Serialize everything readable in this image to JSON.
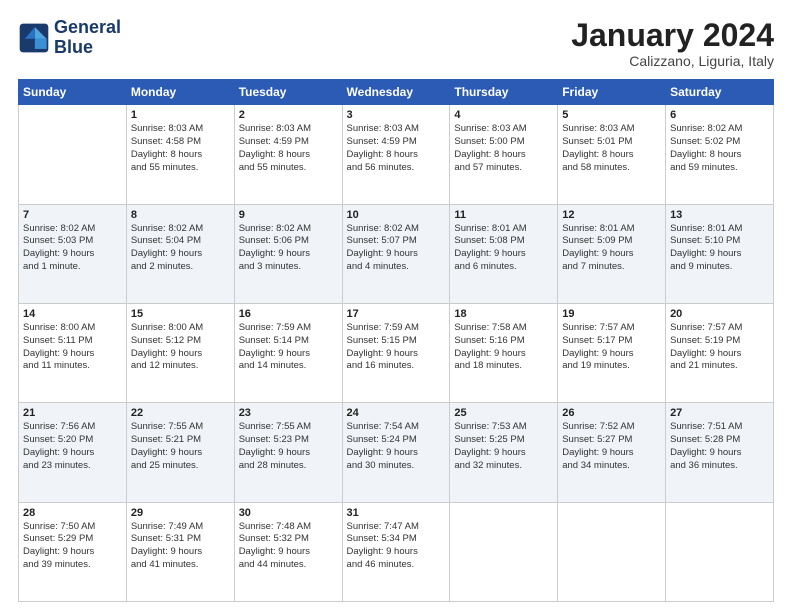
{
  "header": {
    "logo_line1": "General",
    "logo_line2": "Blue",
    "month": "January 2024",
    "location": "Calizzano, Liguria, Italy"
  },
  "columns": [
    "Sunday",
    "Monday",
    "Tuesday",
    "Wednesday",
    "Thursday",
    "Friday",
    "Saturday"
  ],
  "rows": [
    [
      {
        "day": "",
        "text": ""
      },
      {
        "day": "1",
        "text": "Sunrise: 8:03 AM\nSunset: 4:58 PM\nDaylight: 8 hours\nand 55 minutes."
      },
      {
        "day": "2",
        "text": "Sunrise: 8:03 AM\nSunset: 4:59 PM\nDaylight: 8 hours\nand 55 minutes."
      },
      {
        "day": "3",
        "text": "Sunrise: 8:03 AM\nSunset: 4:59 PM\nDaylight: 8 hours\nand 56 minutes."
      },
      {
        "day": "4",
        "text": "Sunrise: 8:03 AM\nSunset: 5:00 PM\nDaylight: 8 hours\nand 57 minutes."
      },
      {
        "day": "5",
        "text": "Sunrise: 8:03 AM\nSunset: 5:01 PM\nDaylight: 8 hours\nand 58 minutes."
      },
      {
        "day": "6",
        "text": "Sunrise: 8:02 AM\nSunset: 5:02 PM\nDaylight: 8 hours\nand 59 minutes."
      }
    ],
    [
      {
        "day": "7",
        "text": "Sunrise: 8:02 AM\nSunset: 5:03 PM\nDaylight: 9 hours\nand 1 minute."
      },
      {
        "day": "8",
        "text": "Sunrise: 8:02 AM\nSunset: 5:04 PM\nDaylight: 9 hours\nand 2 minutes."
      },
      {
        "day": "9",
        "text": "Sunrise: 8:02 AM\nSunset: 5:06 PM\nDaylight: 9 hours\nand 3 minutes."
      },
      {
        "day": "10",
        "text": "Sunrise: 8:02 AM\nSunset: 5:07 PM\nDaylight: 9 hours\nand 4 minutes."
      },
      {
        "day": "11",
        "text": "Sunrise: 8:01 AM\nSunset: 5:08 PM\nDaylight: 9 hours\nand 6 minutes."
      },
      {
        "day": "12",
        "text": "Sunrise: 8:01 AM\nSunset: 5:09 PM\nDaylight: 9 hours\nand 7 minutes."
      },
      {
        "day": "13",
        "text": "Sunrise: 8:01 AM\nSunset: 5:10 PM\nDaylight: 9 hours\nand 9 minutes."
      }
    ],
    [
      {
        "day": "14",
        "text": "Sunrise: 8:00 AM\nSunset: 5:11 PM\nDaylight: 9 hours\nand 11 minutes."
      },
      {
        "day": "15",
        "text": "Sunrise: 8:00 AM\nSunset: 5:12 PM\nDaylight: 9 hours\nand 12 minutes."
      },
      {
        "day": "16",
        "text": "Sunrise: 7:59 AM\nSunset: 5:14 PM\nDaylight: 9 hours\nand 14 minutes."
      },
      {
        "day": "17",
        "text": "Sunrise: 7:59 AM\nSunset: 5:15 PM\nDaylight: 9 hours\nand 16 minutes."
      },
      {
        "day": "18",
        "text": "Sunrise: 7:58 AM\nSunset: 5:16 PM\nDaylight: 9 hours\nand 18 minutes."
      },
      {
        "day": "19",
        "text": "Sunrise: 7:57 AM\nSunset: 5:17 PM\nDaylight: 9 hours\nand 19 minutes."
      },
      {
        "day": "20",
        "text": "Sunrise: 7:57 AM\nSunset: 5:19 PM\nDaylight: 9 hours\nand 21 minutes."
      }
    ],
    [
      {
        "day": "21",
        "text": "Sunrise: 7:56 AM\nSunset: 5:20 PM\nDaylight: 9 hours\nand 23 minutes."
      },
      {
        "day": "22",
        "text": "Sunrise: 7:55 AM\nSunset: 5:21 PM\nDaylight: 9 hours\nand 25 minutes."
      },
      {
        "day": "23",
        "text": "Sunrise: 7:55 AM\nSunset: 5:23 PM\nDaylight: 9 hours\nand 28 minutes."
      },
      {
        "day": "24",
        "text": "Sunrise: 7:54 AM\nSunset: 5:24 PM\nDaylight: 9 hours\nand 30 minutes."
      },
      {
        "day": "25",
        "text": "Sunrise: 7:53 AM\nSunset: 5:25 PM\nDaylight: 9 hours\nand 32 minutes."
      },
      {
        "day": "26",
        "text": "Sunrise: 7:52 AM\nSunset: 5:27 PM\nDaylight: 9 hours\nand 34 minutes."
      },
      {
        "day": "27",
        "text": "Sunrise: 7:51 AM\nSunset: 5:28 PM\nDaylight: 9 hours\nand 36 minutes."
      }
    ],
    [
      {
        "day": "28",
        "text": "Sunrise: 7:50 AM\nSunset: 5:29 PM\nDaylight: 9 hours\nand 39 minutes."
      },
      {
        "day": "29",
        "text": "Sunrise: 7:49 AM\nSunset: 5:31 PM\nDaylight: 9 hours\nand 41 minutes."
      },
      {
        "day": "30",
        "text": "Sunrise: 7:48 AM\nSunset: 5:32 PM\nDaylight: 9 hours\nand 44 minutes."
      },
      {
        "day": "31",
        "text": "Sunrise: 7:47 AM\nSunset: 5:34 PM\nDaylight: 9 hours\nand 46 minutes."
      },
      {
        "day": "",
        "text": ""
      },
      {
        "day": "",
        "text": ""
      },
      {
        "day": "",
        "text": ""
      }
    ]
  ]
}
